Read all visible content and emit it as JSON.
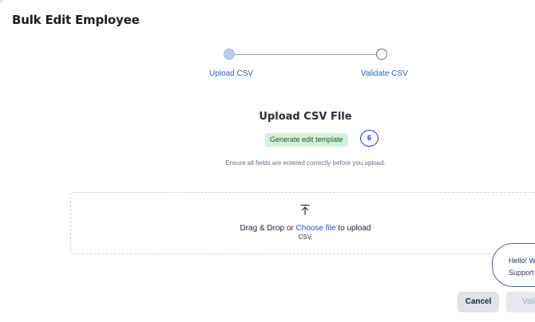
{
  "dialog": {
    "title": "Bulk Edit Employee"
  },
  "stepper": {
    "steps": [
      {
        "label": "Upload CSV",
        "state": "active"
      },
      {
        "label": "Validate CSV",
        "state": "pending"
      }
    ]
  },
  "upload": {
    "section_title": "Upload CSV File",
    "template_button": "Generate edit template",
    "badge_count": "6",
    "hint": "Ensure all fields are entered correctly before you upload.",
    "drop_prefix": "Drag & Drop or ",
    "drop_link": "Choose file",
    "drop_suffix": " to upload",
    "drop_sub": "CSV.",
    "icon": "upload-arrow-icon"
  },
  "chat": {
    "line1": "Hello! W",
    "line2": "Support"
  },
  "footer": {
    "cancel_label": "Cancel",
    "validate_label": "Vali"
  },
  "colors": {
    "accent": "#2c64c4",
    "link": "#2557c4",
    "template_bg": "#d5f0d9",
    "badge": "#1b39c9"
  }
}
